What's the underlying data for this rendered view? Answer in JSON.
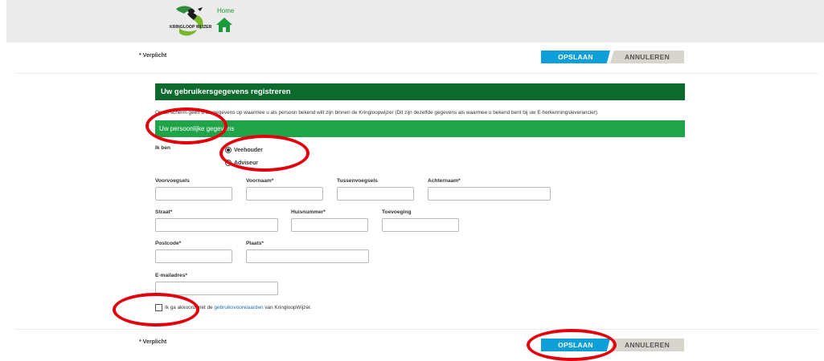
{
  "header": {
    "logo_text": "KRINGLOOP WIJZER",
    "home_label": "Home"
  },
  "required_note": "* Verplicht",
  "buttons": {
    "save": "OPSLAAN",
    "cancel": "ANNULEREN"
  },
  "panel": {
    "title": "Uw gebruikersgegevens registreren",
    "intro": "Op dit scherm geeft u de gegevens op waarmee u als persoon bekend wilt zijn binnen de Kringloopwijzer (Dit zijn dezelfde gegevens als waarmee u bekend bent bij uw E-herkenningsleverancier)."
  },
  "section": {
    "title": "Uw persoonlijke gegevens"
  },
  "role": {
    "label": "Ik ben",
    "options": [
      "Veehouder",
      "Adviseur"
    ],
    "selected": "Veehouder"
  },
  "fields": {
    "voorvoegsels": {
      "label": "Voorvoegsels",
      "value": ""
    },
    "voornaam": {
      "label": "Voornaam*",
      "value": ""
    },
    "tussenvoegsels": {
      "label": "Tussenvoegsels",
      "value": ""
    },
    "achternaam": {
      "label": "Achternaam*",
      "value": ""
    },
    "straat": {
      "label": "Straat*",
      "value": ""
    },
    "huisnummer": {
      "label": "Huisnummer*",
      "value": ""
    },
    "toevoeging": {
      "label": "Toevoeging",
      "value": ""
    },
    "postcode": {
      "label": "Postcode*",
      "value": ""
    },
    "plaats": {
      "label": "Plaats*",
      "value": ""
    },
    "email": {
      "label": "E-mailadres*",
      "value": ""
    }
  },
  "terms": {
    "prefix": "Ik ga akkoord met de ",
    "link": "gebruiksvoorwaarden",
    "suffix": " van KringloopWijzer.",
    "checked": false
  },
  "colors": {
    "dark_green": "#0d6a2d",
    "green": "#1fa44a",
    "blue": "#0e9fd8",
    "annotation_red": "#e3000b"
  }
}
